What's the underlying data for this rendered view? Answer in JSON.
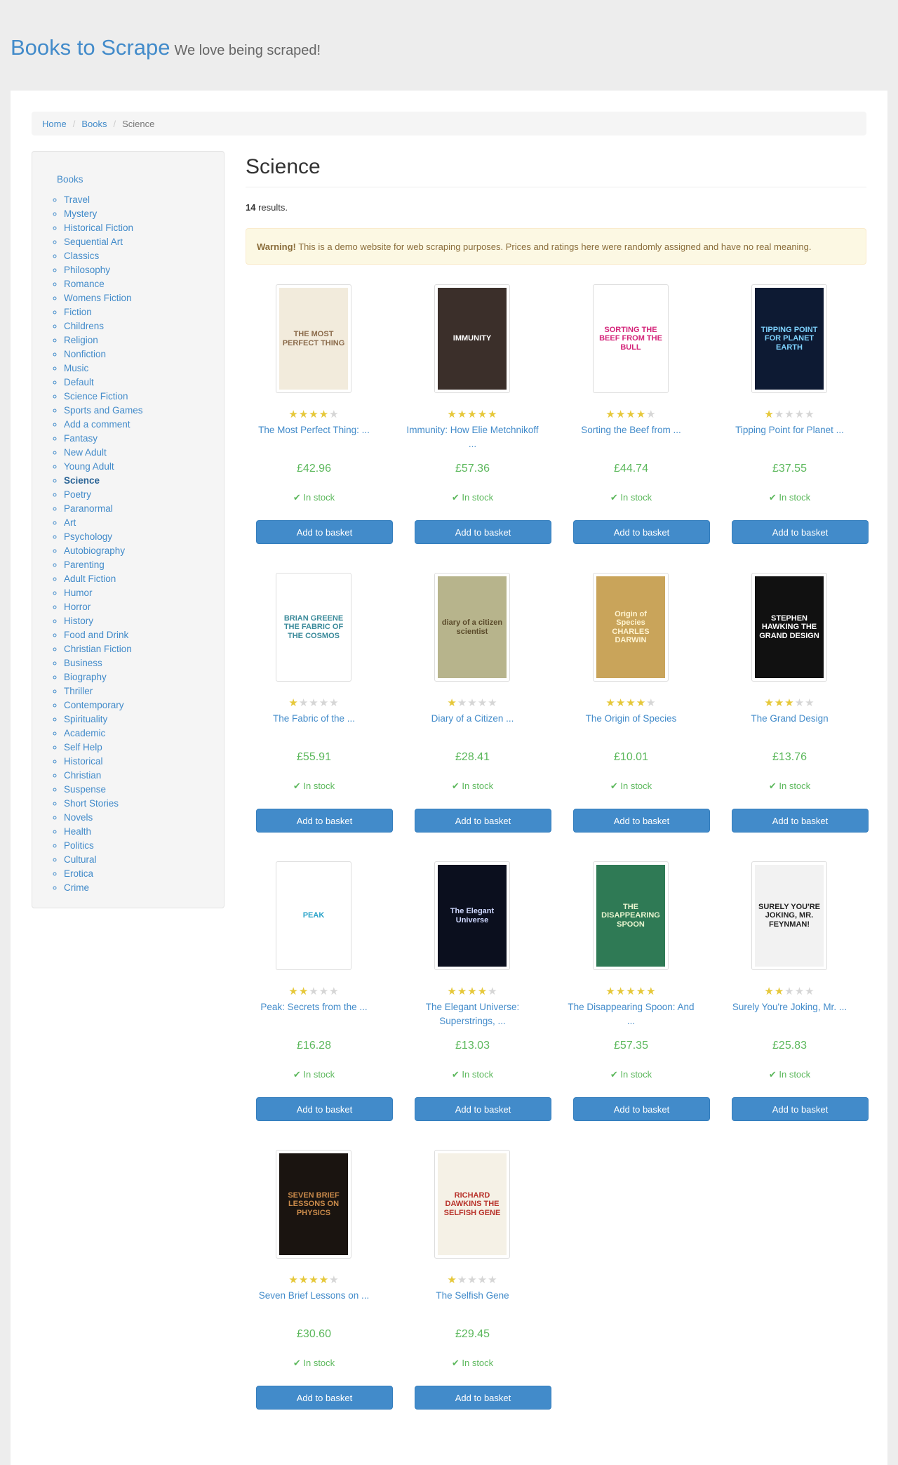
{
  "header": {
    "brand": "Books to Scrape",
    "tagline": "We love being scraped!"
  },
  "breadcrumb": {
    "home": "Home",
    "books": "Books",
    "current": "Science"
  },
  "sidebar": {
    "root_label": "Books",
    "categories": [
      "Travel",
      "Mystery",
      "Historical Fiction",
      "Sequential Art",
      "Classics",
      "Philosophy",
      "Romance",
      "Womens Fiction",
      "Fiction",
      "Childrens",
      "Religion",
      "Nonfiction",
      "Music",
      "Default",
      "Science Fiction",
      "Sports and Games",
      "Add a comment",
      "Fantasy",
      "New Adult",
      "Young Adult",
      "Science",
      "Poetry",
      "Paranormal",
      "Art",
      "Psychology",
      "Autobiography",
      "Parenting",
      "Adult Fiction",
      "Humor",
      "Horror",
      "History",
      "Food and Drink",
      "Christian Fiction",
      "Business",
      "Biography",
      "Thriller",
      "Contemporary",
      "Spirituality",
      "Academic",
      "Self Help",
      "Historical",
      "Christian",
      "Suspense",
      "Short Stories",
      "Novels",
      "Health",
      "Politics",
      "Cultural",
      "Erotica",
      "Crime"
    ],
    "active": "Science"
  },
  "main": {
    "heading": "Science",
    "result_count": "14",
    "results_suffix": " results.",
    "warning_strong": "Warning!",
    "warning_text": " This is a demo website for web scraping purposes. Prices and ratings here were randomly assigned and have no real meaning.",
    "stock_label": "In stock",
    "button_label": "Add to basket",
    "star_glyph": "★"
  },
  "books": [
    {
      "title": "The Most Perfect Thing: ...",
      "rating": 4,
      "price": "£42.96",
      "cover_bg": "#f2ebdc",
      "cover_fg": "#8a6a4a",
      "cover_text": "THE MOST PERFECT THING"
    },
    {
      "title": "Immunity: How Elie Metchnikoff ...",
      "rating": 5,
      "price": "£57.36",
      "cover_bg": "#3b2f2a",
      "cover_fg": "#ffffff",
      "cover_text": "IMMUNITY"
    },
    {
      "title": "Sorting the Beef from ...",
      "rating": 4,
      "price": "£44.74",
      "cover_bg": "#ffffff",
      "cover_fg": "#d4257a",
      "cover_text": "SORTING THE BEEF FROM THE BULL"
    },
    {
      "title": "Tipping Point for Planet ...",
      "rating": 1,
      "price": "£37.55",
      "cover_bg": "#0d1a33",
      "cover_fg": "#7fd3ff",
      "cover_text": "TIPPING POINT FOR PLANET EARTH"
    },
    {
      "title": "The Fabric of the ...",
      "rating": 1,
      "price": "£55.91",
      "cover_bg": "#ffffff",
      "cover_fg": "#3a8a9a",
      "cover_text": "BRIAN GREENE THE FABRIC OF THE COSMOS"
    },
    {
      "title": "Diary of a Citizen ...",
      "rating": 1,
      "price": "£28.41",
      "cover_bg": "#b7b48c",
      "cover_fg": "#5a4a2a",
      "cover_text": "diary of a citizen scientist"
    },
    {
      "title": "The Origin of Species",
      "rating": 4,
      "price": "£10.01",
      "cover_bg": "#c9a45a",
      "cover_fg": "#fff4d0",
      "cover_text": "Origin of Species CHARLES DARWIN"
    },
    {
      "title": "The Grand Design",
      "rating": 3,
      "price": "£13.76",
      "cover_bg": "#111111",
      "cover_fg": "#ffffff",
      "cover_text": "STEPHEN HAWKING THE GRAND DESIGN"
    },
    {
      "title": "Peak: Secrets from the ...",
      "rating": 2,
      "price": "£16.28",
      "cover_bg": "#ffffff",
      "cover_fg": "#2aa3c9",
      "cover_text": "PEAK"
    },
    {
      "title": "The Elegant Universe: Superstrings, ...",
      "rating": 4,
      "price": "£13.03",
      "cover_bg": "#0b0f1e",
      "cover_fg": "#cfd8ff",
      "cover_text": "The Elegant Universe"
    },
    {
      "title": "The Disappearing Spoon: And ...",
      "rating": 5,
      "price": "£57.35",
      "cover_bg": "#2f7a55",
      "cover_fg": "#eaf5d0",
      "cover_text": "THE DISAPPEARING SPOON"
    },
    {
      "title": "Surely You're Joking, Mr. ...",
      "rating": 2,
      "price": "£25.83",
      "cover_bg": "#f2f2f2",
      "cover_fg": "#222222",
      "cover_text": "SURELY YOU'RE JOKING, MR. FEYNMAN!"
    },
    {
      "title": "Seven Brief Lessons on ...",
      "rating": 4,
      "price": "£30.60",
      "cover_bg": "#1a1410",
      "cover_fg": "#c98a4a",
      "cover_text": "SEVEN BRIEF LESSONS ON PHYSICS"
    },
    {
      "title": "The Selfish Gene",
      "rating": 1,
      "price": "£29.45",
      "cover_bg": "#f5f1e6",
      "cover_fg": "#b8322a",
      "cover_text": "RICHARD DAWKINS THE SELFISH GENE"
    }
  ]
}
